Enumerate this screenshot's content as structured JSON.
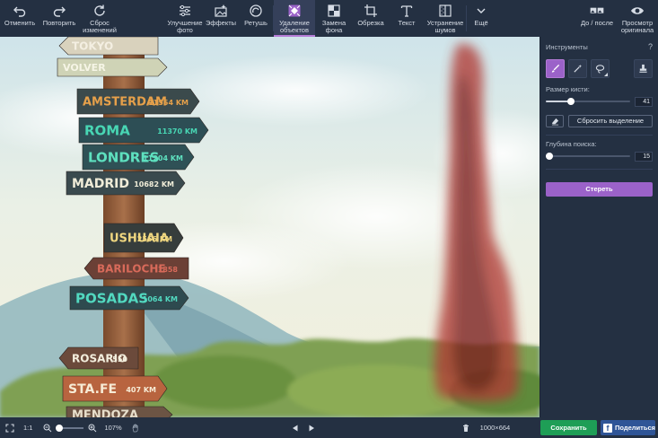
{
  "toolbar": {
    "undo": "Отменить",
    "redo": "Повторить",
    "reset": "Сброс\nизменений",
    "enhance": "Улучшение\nфото",
    "effects": "Эффекты",
    "retouch": "Ретушь",
    "remove_objects": "Удаление\nобъектов",
    "replace_bg": "Замена\nфона",
    "crop": "Обрезка",
    "text": "Текст",
    "denoise": "Устранение\nшумов",
    "more": "Ещё",
    "before_after": "До / после",
    "view_original": "Просмотр\nоригинала"
  },
  "panel": {
    "title": "Инструменты",
    "help": "?",
    "brush_size_label": "Размер кисти:",
    "brush_size_value": "41",
    "brush_size_fraction": 0.3,
    "reset_selection": "Сбросить выделение",
    "search_depth_label": "Глубина поиска:",
    "search_depth_value": "15",
    "search_depth_fraction": 0.04,
    "erase": "Стереть"
  },
  "bottombar": {
    "fit": "1:1",
    "zoom": "107%",
    "zoom_fraction": 0.1,
    "image_size": "1000×664",
    "save": "Сохранить",
    "share": "Поделиться",
    "fb_letter": "f"
  },
  "signs": [
    {
      "text": "TOKYO",
      "color": "#d9d2bd",
      "textColor": "#f4efe2"
    },
    {
      "text": "VOLVER",
      "color": "#cfd3b6",
      "textColor": "#f6f5e6"
    },
    {
      "text": "AMSTERDAM",
      "sub": "11554 KM",
      "color": "#3b4a4c",
      "textColor": "#e6a04a"
    },
    {
      "text": "ROMA",
      "sub": "11370 KM",
      "color": "#2d4e55",
      "textColor": "#48d6b4"
    },
    {
      "text": "LONDRES",
      "sub": "11204 KM",
      "color": "#2f5156",
      "textColor": "#5ee0bf"
    },
    {
      "text": "MADRID",
      "sub": "10682 KM",
      "color": "#3a4a4e",
      "textColor": "#f0ecd8"
    },
    {
      "text": "USHUAIA",
      "sub": "2566 KM",
      "color": "#363d3c",
      "textColor": "#f0d780"
    },
    {
      "text": "BARILOCHE",
      "sub": "1858",
      "color": "#6b4036",
      "textColor": "#d86a5a"
    },
    {
      "text": "POSADAS",
      "sub": "1064 KM",
      "color": "#2e4a4f",
      "textColor": "#52d9c0"
    },
    {
      "text": "ROSARIO",
      "sub": "550",
      "color": "#6b4a3b",
      "textColor": "#f3eedd"
    },
    {
      "text": "STA.FE",
      "sub": "407 KM",
      "color": "#b8643f",
      "textColor": "#f7ebd5"
    },
    {
      "text": "MENDOZA",
      "color": "#6c5444",
      "textColor": "#e8dfcc"
    }
  ],
  "colors": {
    "accent": "#9b62c9",
    "selection": "#a8322f",
    "save": "#1e9e56",
    "share": "#2f5597"
  }
}
